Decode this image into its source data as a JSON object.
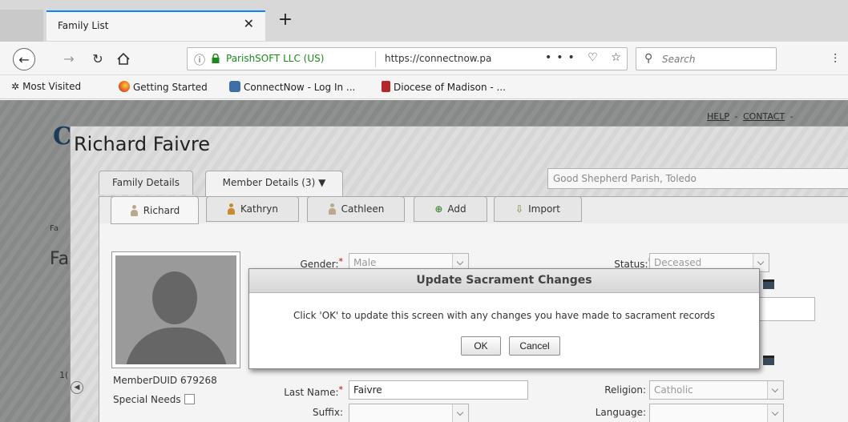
{
  "browser": {
    "tab_title": "Family List",
    "tab_close": "✕",
    "new_tab": "+",
    "url_org": "ParishSOFT LLC (US)",
    "url": "https://connectnow.pa",
    "url_actions": "••• ♡ ☆",
    "search_placeholder": "Search",
    "bookmarks": [
      "Most Visited",
      "Getting Started",
      "ConnectNow - Log In ...",
      "Diocese of Madison - ..."
    ]
  },
  "page": {
    "logo_letter": "C",
    "help_links": [
      "HELP",
      "CONTACT"
    ],
    "fragments": [
      "Fa",
      "Fa",
      "1("
    ]
  },
  "modal": {
    "title": "Richard Faivre",
    "tabs": [
      "Family Details",
      "Member Details (3)  ▼"
    ],
    "parish": "Good Shepherd Parish, Toledo",
    "member_tabs": [
      "Richard",
      "Kathryn",
      "Cathleen",
      "Add",
      "Import"
    ],
    "member_duid": "MemberDUID 679268",
    "special_needs": "Special Needs",
    "fields": {
      "gender_label": "Gender:",
      "gender_value": "Male",
      "status_label": "Status:",
      "status_value": "Deceased",
      "last_name_label": "Last Name:",
      "last_name_value": "Faivre",
      "suffix_label": "Suffix:",
      "religion_label": "Religion:",
      "religion_value": "Catholic",
      "language_label": "Language:",
      "required_mark": "*"
    }
  },
  "dialog": {
    "title": "Update Sacrament Changes",
    "message": "Click 'OK' to update this screen with any changes you have made to sacrament records",
    "ok": "OK",
    "cancel": "Cancel"
  },
  "colors": {
    "tab_accent": "#0a84ff",
    "secure_green": "#1a8a1a",
    "required_red": "#cc0000"
  }
}
